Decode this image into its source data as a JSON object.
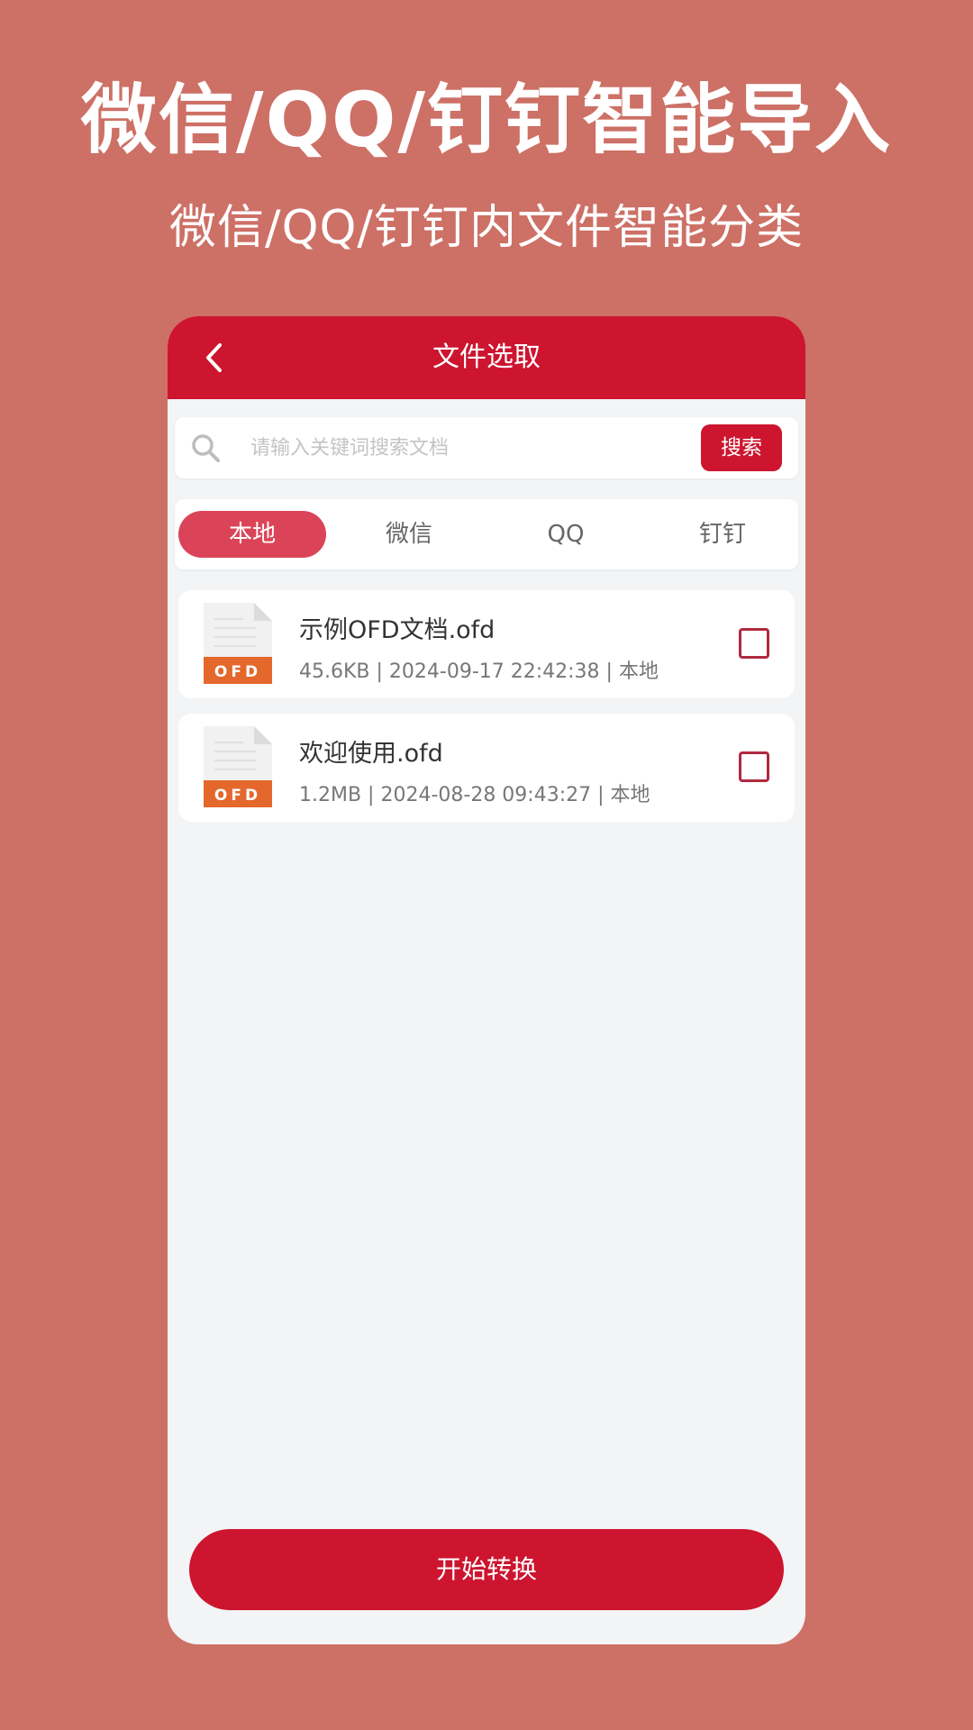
{
  "promo": {
    "title": "微信/QQ/钉钉智能导入",
    "subtitle": "微信/QQ/钉钉内文件智能分类"
  },
  "header": {
    "title": "文件选取",
    "back_icon": "chevron-left-icon"
  },
  "search": {
    "placeholder": "请输入关键词搜索文档",
    "value": "",
    "button_label": "搜索",
    "icon": "search-icon"
  },
  "tabs": [
    {
      "label": "本地",
      "active": true
    },
    {
      "label": "微信",
      "active": false
    },
    {
      "label": "QQ",
      "active": false
    },
    {
      "label": "钉钉",
      "active": false
    }
  ],
  "files": [
    {
      "name": "示例OFD文档.ofd",
      "meta": "45.6KB | 2024-09-17 22:42:38 | 本地",
      "badge": "OFD",
      "checked": false
    },
    {
      "name": "欢迎使用.ofd",
      "meta": "1.2MB | 2024-08-28 09:43:27 | 本地",
      "badge": "OFD",
      "checked": false
    }
  ],
  "footer": {
    "start_label": "开始转换"
  },
  "colors": {
    "background": "#cd7066",
    "primary": "#cd152f",
    "tab_active": "#db4458",
    "badge": "#e4672b"
  }
}
